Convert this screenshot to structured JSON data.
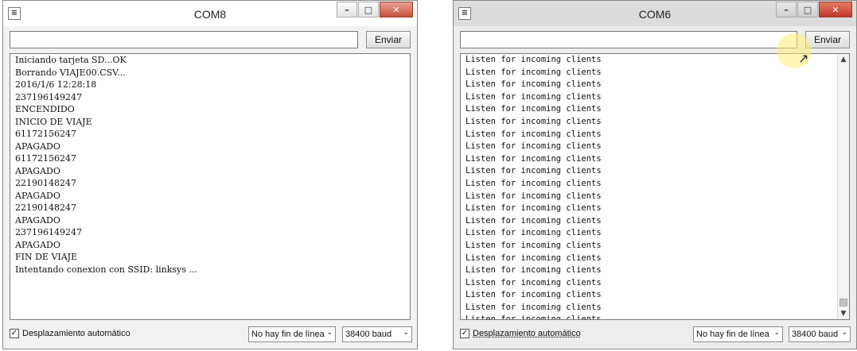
{
  "window1": {
    "title": "COM8",
    "send_label": "Enviar",
    "send_value": "",
    "output_lines": [
      "Iniciando tarjeta SD...OK",
      "Borrando VIAJE00.CSV...",
      "2016/1/6 12:28:18",
      "237196149247",
      "ENCENDIDO",
      "INICIO DE VIAJE",
      "61172156247",
      "APAGADO",
      "61172156247",
      "APAGADO",
      "22190148247",
      "APAGADO",
      "22190148247",
      "APAGADO",
      "237196149247",
      "APAGADO",
      "FIN DE VIAJE",
      "Intentando conexion con SSID: linksys ..."
    ],
    "autoscroll_label": "Desplazamiento automático",
    "autoscroll_checked": true,
    "line_ending": "No hay fin de línea",
    "baud": "38400 baud"
  },
  "window2": {
    "title": "COM6",
    "send_label": "Enviar",
    "send_value": "",
    "output_lines": [
      "Listen for incoming clients",
      "Listen for incoming clients",
      "Listen for incoming clients",
      "Listen for incoming clients",
      "Listen for incoming clients",
      "Listen for incoming clients",
      "Listen for incoming clients",
      "Listen for incoming clients",
      "Listen for incoming clients",
      "Listen for incoming clients",
      "Listen for incoming clients",
      "Listen for incoming clients",
      "Listen for incoming clients",
      "Listen for incoming clients",
      "Listen for incoming clients",
      "Listen for incoming clients",
      "Listen for incoming clients",
      "Listen for incoming clients",
      "Listen for incoming clients",
      "Listen for incoming clients",
      "Listen for incoming clients",
      "Listen for incoming clients",
      "Listen for inco"
    ],
    "autoscroll_label": "Desplazamiento automático",
    "autoscroll_checked": true,
    "line_ending": "No hay fin de línea",
    "baud": "38400 baud"
  },
  "icons": {
    "app": "arduino-serial-icon",
    "minimize": "minimize-icon",
    "maximize": "maximize-icon",
    "close": "close-icon",
    "dropdown": "chevron-down-icon",
    "cursor": "mouse-pointer-icon"
  },
  "colors": {
    "close_button": "#c7513d",
    "cursor_highlight": "#ffec78"
  }
}
